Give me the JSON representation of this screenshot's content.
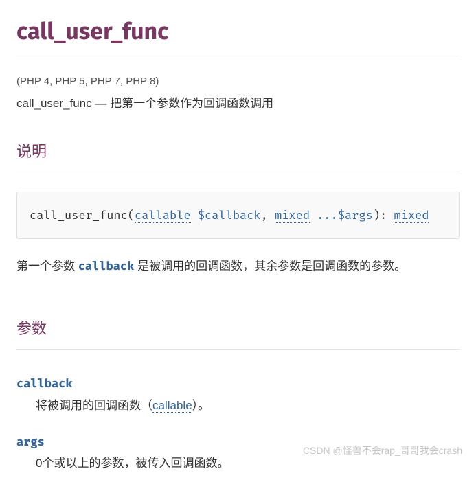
{
  "title": "call_user_func",
  "version_info": "(PHP 4, PHP 5, PHP 7, PHP 8)",
  "summary_func": "call_user_func",
  "summary_sep": " — ",
  "summary_text": "把第一个参数作为回调函数调用",
  "sections": {
    "description": {
      "heading": "说明",
      "synopsis": {
        "func_name": "call_user_func",
        "paren_open": "(",
        "type1": "callable",
        "param1": " $callback",
        "comma": ", ",
        "type2": "mixed",
        "param2": " ...$args",
        "paren_close": "): ",
        "return_type": "mixed"
      },
      "desc_pre": "第一个参数 ",
      "desc_code": "callback",
      "desc_post": " 是被调用的回调函数，其余参数是回调函数的参数。"
    },
    "parameters": {
      "heading": "参数",
      "items": [
        {
          "name": "callback",
          "desc_pre": "将被调用的回调函数（",
          "desc_link": "callable",
          "desc_post": "）。"
        },
        {
          "name": "args",
          "desc_pre": "0个或以上的参数，被传入回调函数。",
          "desc_link": "",
          "desc_post": ""
        }
      ]
    }
  },
  "watermark": "CSDN @怪兽不会rap_哥哥我会crash"
}
